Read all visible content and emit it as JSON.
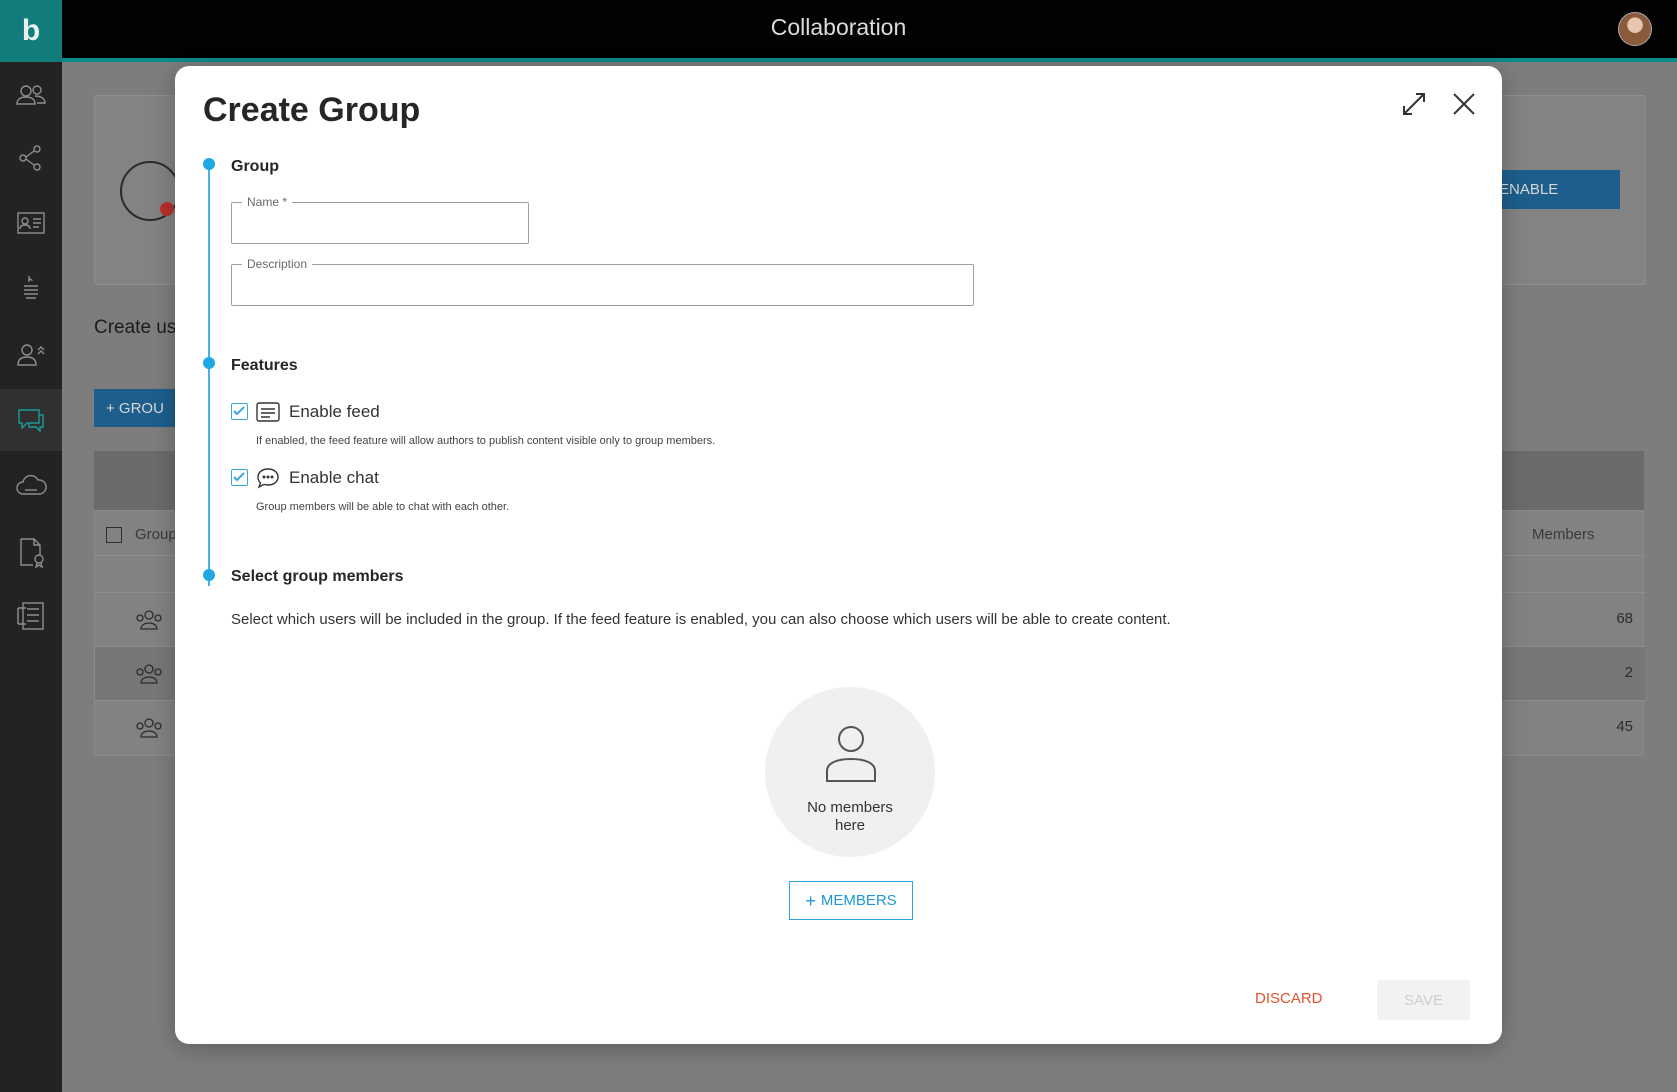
{
  "header": {
    "title": "Collaboration",
    "logo_letter": "b"
  },
  "sidebar": {
    "items": [
      {
        "icon": "users-icon"
      },
      {
        "icon": "share-nodes-icon"
      },
      {
        "icon": "contact-card-icon"
      },
      {
        "icon": "brand-stack-icon"
      },
      {
        "icon": "user-admin-icon"
      },
      {
        "icon": "chat-icon",
        "active": true
      },
      {
        "icon": "cloud-icon"
      },
      {
        "icon": "certificate-document-icon"
      },
      {
        "icon": "workflow-icon"
      }
    ]
  },
  "background": {
    "enable_label": "ENABLE",
    "create_text": "Create us",
    "add_button_label": "+ GROU",
    "table": {
      "columns": [
        "Group",
        "Members"
      ],
      "rows": [
        {
          "members": "68"
        },
        {
          "members": "2"
        },
        {
          "members": "45"
        }
      ]
    }
  },
  "modal": {
    "title": "Create Group",
    "group_section": {
      "label": "Group",
      "name_label": "Name *",
      "name_value": "",
      "description_label": "Description",
      "description_value": ""
    },
    "features_section": {
      "label": "Features",
      "feed": {
        "label": "Enable feed",
        "checked": true,
        "hint": "If enabled, the feed feature will allow authors to publish content visible only to group members."
      },
      "chat": {
        "label": "Enable chat",
        "checked": true,
        "hint": "Group members will be able to chat with each other."
      }
    },
    "members_section": {
      "label": "Select group members",
      "description": "Select which users will be included in the group. If the feed feature is enabled, you can also choose which users will be able to create content.",
      "empty_line1": "No members",
      "empty_line2": "here",
      "add_button_label": "MEMBERS"
    },
    "footer": {
      "discard_label": "DISCARD",
      "save_label": "SAVE"
    }
  },
  "colors": {
    "accent": "#1fa8e3",
    "topbar_border": "#0e8a8a",
    "discard": "#e0532e"
  }
}
